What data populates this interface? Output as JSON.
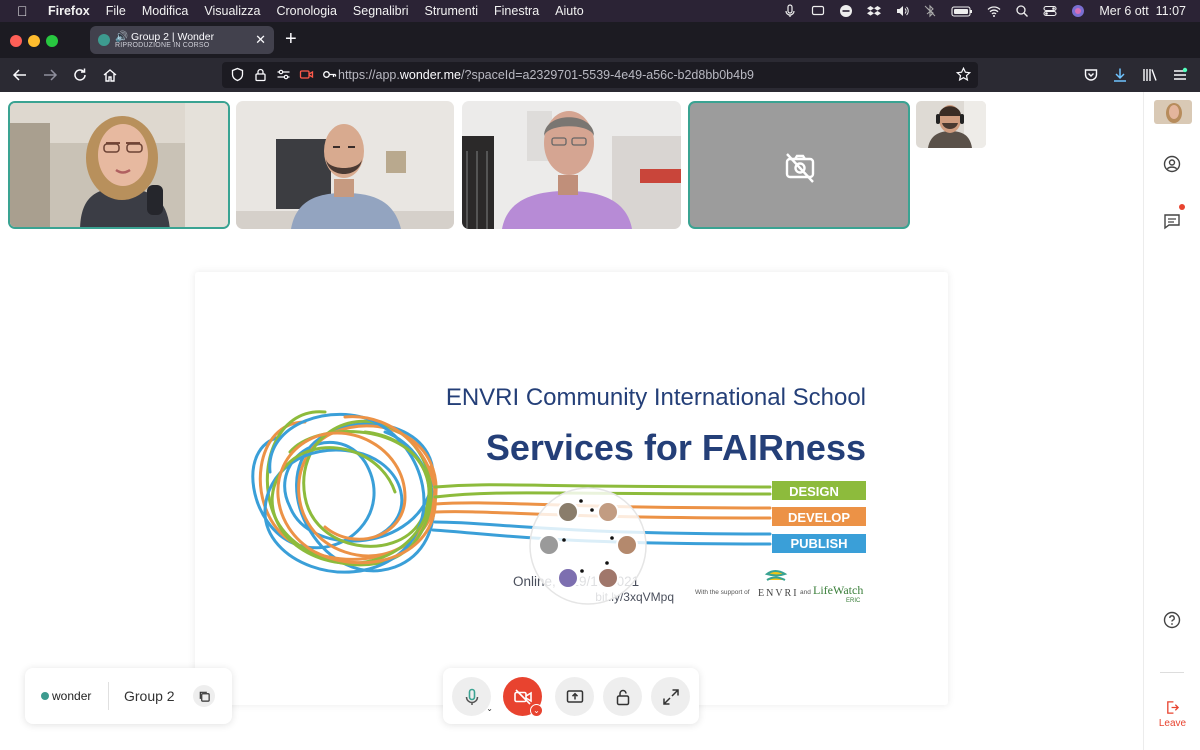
{
  "menubar": {
    "items": [
      "Firefox",
      "File",
      "Modifica",
      "Visualizza",
      "Cronologia",
      "Segnalibri",
      "Strumenti",
      "Finestra",
      "Aiuto"
    ],
    "clock": "Mer 6 ott  11:07"
  },
  "browser": {
    "tab_title": "Group 2 | Wonder",
    "tab_subtitle": "RIPRODUZIONE IN CORSO",
    "url_prefix": "https://app.",
    "url_domain": "wonder.me",
    "url_path": "/?spaceId=a2329701-5539-4e49-a56c-b2d8bb0b4b9"
  },
  "slide": {
    "heading": "ENVRI Community International School",
    "title": "Services for FAIRness",
    "bands": [
      "DESIGN",
      "DEVELOP",
      "PUBLISH"
    ],
    "date": "Online, 4-29/10/2021",
    "link": "bit.ly/3xqVMpq",
    "support": "With the support of",
    "logo1": "ENVRI",
    "and_label": "and",
    "logo2": "LifeWatch",
    "logo2_sub": "ERIC"
  },
  "footer": {
    "brand": "wonder",
    "group": "Group 2"
  },
  "sidebar": {
    "leave": "Leave"
  },
  "colors": {
    "accent": "#3aa392",
    "camera_off": "#e8432f",
    "green": "#8dbb3c",
    "orange": "#ec9246",
    "blue": "#3a9fd8",
    "navy": "#243f78"
  }
}
